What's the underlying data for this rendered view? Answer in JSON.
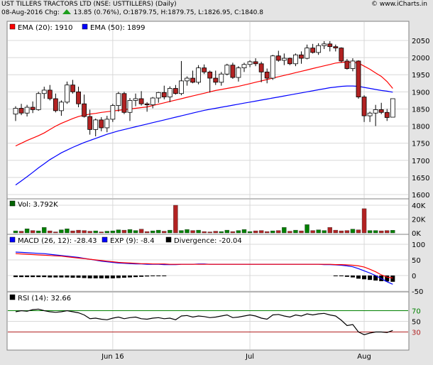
{
  "header": {
    "title": "UST TILLERS TRACTORS LTD (NSE: USTTILLERS) (Daily)",
    "quote": "08-Aug-2016 Chg: 13.85 (0.76%), O:1879.75, H:1879.75, L:1826.95, C:1840.8",
    "date": "08-Aug-2016",
    "chg_label": "Chg:",
    "chg": "13.85 (0.76%), O:1879.75, H:1879.75, L:1826.95, C:1840.8",
    "brand": "© www.iCharts.in"
  },
  "colors": {
    "up": "#ffffff",
    "down": "#b22222",
    "ema20": "#ff0000",
    "ema50": "#0000ff",
    "macd": "#0000ff",
    "signal": "#ff0000",
    "divergence": "#000000",
    "volume_up": "#008000",
    "volume_down": "#b22222",
    "rsi": "#000000",
    "rsi_overbought": "#008000",
    "rsi_oversold": "#b22222"
  },
  "chart_data": [
    {
      "type": "candlestick",
      "panel": "price",
      "legend": [
        {
          "label": "EMA (20): 1910",
          "color": "#ff0000"
        },
        {
          "label": "EMA (50): 1899",
          "color": "#0000ff"
        }
      ],
      "ylim": [
        1600,
        2075
      ],
      "yticks": [
        "2050",
        "2000",
        "1950",
        "1900",
        "1850",
        "1800",
        "1750",
        "1700",
        "1650",
        "1600"
      ],
      "x_labels": [
        {
          "label": "Jun 16",
          "index": 17
        },
        {
          "label": "Jul",
          "index": 41
        },
        {
          "label": "Aug",
          "index": 61
        }
      ],
      "grid": true,
      "ohlc": [
        [
          1835,
          1858,
          1815,
          1852
        ],
        [
          1852,
          1865,
          1832,
          1838
        ],
        [
          1838,
          1862,
          1828,
          1855
        ],
        [
          1855,
          1872,
          1838,
          1848
        ],
        [
          1848,
          1900,
          1845,
          1895
        ],
        [
          1895,
          1915,
          1880,
          1905
        ],
        [
          1905,
          1920,
          1875,
          1880
        ],
        [
          1880,
          1895,
          1840,
          1845
        ],
        [
          1845,
          1875,
          1830,
          1870
        ],
        [
          1870,
          1930,
          1865,
          1920
        ],
        [
          1920,
          1935,
          1895,
          1900
        ],
        [
          1900,
          1915,
          1855,
          1865
        ],
        [
          1865,
          1892,
          1825,
          1828
        ],
        [
          1828,
          1848,
          1775,
          1790
        ],
        [
          1790,
          1822,
          1770,
          1818
        ],
        [
          1818,
          1826,
          1785,
          1795
        ],
        [
          1795,
          1830,
          1782,
          1820
        ],
        [
          1820,
          1865,
          1812,
          1860
        ],
        [
          1860,
          1900,
          1842,
          1895
        ],
        [
          1895,
          1900,
          1835,
          1840
        ],
        [
          1840,
          1882,
          1815,
          1875
        ],
        [
          1875,
          1895,
          1858,
          1880
        ],
        [
          1880,
          1902,
          1860,
          1865
        ],
        [
          1865,
          1870,
          1842,
          1862
        ],
        [
          1862,
          1885,
          1852,
          1882
        ],
        [
          1882,
          1900,
          1868,
          1898
        ],
        [
          1898,
          1918,
          1878,
          1885
        ],
        [
          1885,
          1916,
          1870,
          1910
        ],
        [
          1910,
          1920,
          1892,
          1895
        ],
        [
          1895,
          1990,
          1890,
          1932
        ],
        [
          1932,
          1945,
          1918,
          1940
        ],
        [
          1940,
          1962,
          1925,
          1928
        ],
        [
          1928,
          1978,
          1922,
          1970
        ],
        [
          1970,
          1980,
          1952,
          1958
        ],
        [
          1958,
          1962,
          1898,
          1940
        ],
        [
          1940,
          1962,
          1920,
          1928
        ],
        [
          1928,
          1958,
          1918,
          1952
        ],
        [
          1952,
          1982,
          1948,
          1978
        ],
        [
          1978,
          1985,
          1938,
          1942
        ],
        [
          1942,
          1975,
          1930,
          1970
        ],
        [
          1970,
          1985,
          1958,
          1980
        ],
        [
          1980,
          1992,
          1972,
          1988
        ],
        [
          1988,
          1998,
          1975,
          1982
        ],
        [
          1982,
          1988,
          1928,
          1958
        ],
        [
          1958,
          1968,
          1925,
          1940
        ],
        [
          1940,
          2008,
          1935,
          2005
        ],
        [
          2005,
          2020,
          1988,
          1992
        ],
        [
          1992,
          2012,
          1978,
          1998
        ],
        [
          1998,
          2000,
          1978,
          1982
        ],
        [
          1982,
          2012,
          1975,
          2008
        ],
        [
          2008,
          2018,
          1982,
          1998
        ],
        [
          1998,
          2038,
          1995,
          2028
        ],
        [
          2028,
          2040,
          2012,
          2015
        ],
        [
          2015,
          2042,
          2008,
          2035
        ],
        [
          2035,
          2048,
          2025,
          2040
        ],
        [
          2040,
          2048,
          2018,
          2032
        ],
        [
          2032,
          2038,
          2018,
          2028
        ],
        [
          2028,
          2030,
          1985,
          1990
        ],
        [
          1990,
          1996,
          1965,
          1968
        ],
        [
          1968,
          1998,
          1960,
          1990
        ],
        [
          1990,
          1992,
          1880,
          1885
        ],
        [
          1885,
          1890,
          1812,
          1830
        ],
        [
          1830,
          1842,
          1812,
          1838
        ],
        [
          1838,
          1862,
          1800,
          1848
        ],
        [
          1848,
          1868,
          1835,
          1840
        ],
        [
          1840,
          1850,
          1815,
          1825
        ],
        [
          1826,
          1880,
          1826,
          1880
        ]
      ],
      "ema20": [
        1742,
        1750,
        1758,
        1765,
        1772,
        1780,
        1790,
        1800,
        1808,
        1815,
        1822,
        1828,
        1832,
        1835,
        1837,
        1840,
        1842,
        1844,
        1846,
        1848,
        1850,
        1852,
        1854,
        1856,
        1860,
        1864,
        1868,
        1872,
        1876,
        1880,
        1884,
        1888,
        1892,
        1896,
        1900,
        1904,
        1907,
        1910,
        1913,
        1916,
        1920,
        1924,
        1928,
        1932,
        1936,
        1940,
        1944,
        1948,
        1952,
        1956,
        1960,
        1964,
        1968,
        1972,
        1976,
        1980,
        1984,
        1986,
        1987,
        1986,
        1984,
        1975,
        1966,
        1955,
        1945,
        1930,
        1910
      ],
      "ema50": [
        1628,
        1640,
        1652,
        1665,
        1678,
        1690,
        1702,
        1712,
        1722,
        1730,
        1738,
        1745,
        1752,
        1758,
        1764,
        1770,
        1776,
        1781,
        1786,
        1790,
        1794,
        1798,
        1802,
        1806,
        1810,
        1814,
        1818,
        1822,
        1826,
        1830,
        1834,
        1838,
        1842,
        1846,
        1849,
        1852,
        1855,
        1858,
        1861,
        1864,
        1867,
        1870,
        1873,
        1876,
        1879,
        1882,
        1885,
        1888,
        1891,
        1894,
        1897,
        1900,
        1903,
        1906,
        1909,
        1912,
        1914,
        1916,
        1917,
        1917,
        1916,
        1913,
        1910,
        1907,
        1904,
        1902,
        1899
      ]
    },
    {
      "type": "bar",
      "panel": "volume",
      "legend": [
        {
          "label": "Vol: 3.792K",
          "color": "#006400"
        }
      ],
      "ylim": [
        0,
        45000
      ],
      "yticks": [
        "40K",
        "20K",
        "0K"
      ],
      "values": [
        3000,
        2500,
        6000,
        3500,
        3000,
        8000,
        3000,
        1500,
        4500,
        6000,
        3000,
        4000,
        3500,
        2500,
        3000,
        1500,
        2500,
        3000,
        4500,
        4000,
        5000,
        3500,
        5500,
        2000,
        3000,
        4000,
        2500,
        4000,
        40000,
        3500,
        5000,
        3500,
        4000,
        2000,
        1500,
        2500,
        2000,
        4000,
        2000,
        3500,
        5000,
        2000,
        3000,
        3500,
        2000,
        3000,
        3500,
        8000,
        2500,
        4000,
        3000,
        12000,
        3500,
        4500,
        3500,
        8000,
        4000,
        3000,
        3500,
        5500,
        4500,
        35000,
        3500,
        3500,
        3000,
        3500,
        3792
      ]
    },
    {
      "type": "line",
      "panel": "macd",
      "legend": [
        {
          "label": "MACD (26, 12): -28.43",
          "color": "#0000ff"
        },
        {
          "label": "EXP (9): -8.4",
          "color": "#0000ff"
        },
        {
          "label": "Divergence: -20.04",
          "color": "#000000"
        }
      ],
      "ylim": [
        -60,
        110
      ],
      "yticks": [
        "100",
        "50",
        "0",
        "-50"
      ],
      "macd": [
        75,
        74,
        73,
        72,
        71,
        70,
        68,
        66,
        64,
        62,
        60,
        58,
        55,
        52,
        49,
        46,
        44,
        42,
        40,
        39,
        38,
        37,
        37,
        36,
        36,
        36,
        35,
        35,
        35,
        36,
        36,
        36,
        37,
        37,
        36,
        36,
        36,
        36,
        36,
        36,
        36,
        36,
        36,
        36,
        36,
        36,
        36,
        36,
        36,
        36,
        36,
        36,
        36,
        36,
        35,
        35,
        34,
        33,
        31,
        28,
        22,
        15,
        8,
        0,
        -10,
        -20,
        -28
      ],
      "signal": [
        70,
        69,
        68,
        67,
        66,
        65,
        64,
        63,
        62,
        60,
        58,
        56,
        54,
        52,
        50,
        48,
        46,
        44,
        42,
        41,
        40,
        39,
        38,
        38,
        37,
        37,
        37,
        36,
        36,
        36,
        36,
        36,
        36,
        36,
        36,
        36,
        36,
        36,
        36,
        36,
        36,
        36,
        36,
        36,
        36,
        36,
        36,
        36,
        36,
        36,
        36,
        36,
        36,
        36,
        36,
        36,
        35,
        35,
        34,
        33,
        31,
        27,
        20,
        12,
        2,
        -5,
        -8
      ],
      "divergence": [
        -5,
        -5,
        -5,
        -5,
        -5,
        -5,
        -6,
        -6,
        -6,
        -6,
        -7,
        -7,
        -8,
        -9,
        -9,
        -9,
        -9,
        -9,
        -8,
        -7,
        -6,
        -5,
        -4,
        -3,
        -2,
        -1,
        -1,
        0,
        0,
        0,
        0,
        0,
        0,
        0,
        0,
        0,
        0,
        0,
        0,
        0,
        0,
        0,
        0,
        0,
        0,
        0,
        0,
        0,
        0,
        0,
        0,
        0,
        0,
        0,
        0,
        0,
        -1,
        -2,
        -4,
        -6,
        -10,
        -12,
        -14,
        -16,
        -18,
        -19,
        -20
      ]
    },
    {
      "type": "line",
      "panel": "rsi",
      "legend": [
        {
          "label": "RSI (14): 32.66",
          "color": "#000000"
        }
      ],
      "ylim": [
        0,
        100
      ],
      "yticks": [
        "70",
        "50",
        "30"
      ],
      "overbought": 70,
      "oversold": 30,
      "values": [
        68,
        70,
        69,
        72,
        73,
        70,
        68,
        67,
        68,
        70,
        68,
        66,
        62,
        55,
        56,
        54,
        53,
        56,
        58,
        55,
        57,
        58,
        55,
        54,
        56,
        57,
        55,
        56,
        53,
        60,
        61,
        58,
        60,
        59,
        57,
        58,
        60,
        62,
        57,
        58,
        60,
        62,
        60,
        56,
        54,
        62,
        63,
        60,
        58,
        62,
        60,
        64,
        62,
        64,
        65,
        62,
        60,
        52,
        42,
        44,
        30,
        25,
        28,
        30,
        30,
        29,
        33
      ]
    }
  ]
}
